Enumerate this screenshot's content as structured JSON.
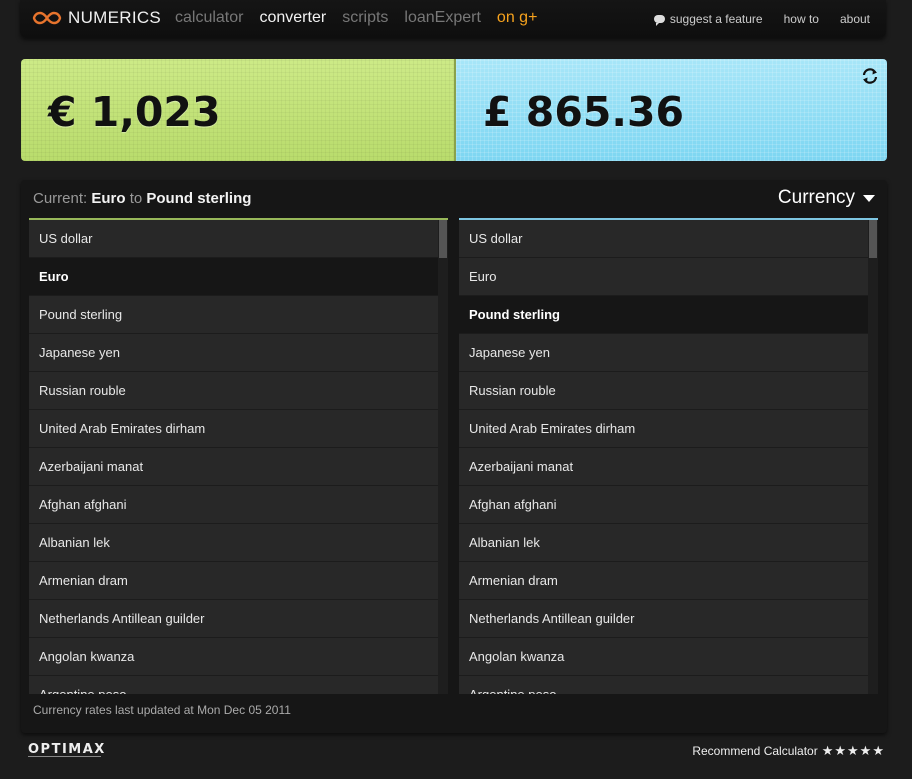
{
  "header": {
    "logo_text": "NUMERICS",
    "nav": [
      {
        "label": "calculator",
        "state": "inactive"
      },
      {
        "label": "converter",
        "state": "active"
      },
      {
        "label": "scripts",
        "state": "inactive"
      },
      {
        "label": "loanExpert",
        "state": "inactive"
      },
      {
        "label": "on g+",
        "state": "highlight"
      }
    ],
    "suggest_label": "suggest a feature",
    "howto_label": "how to",
    "about_label": "about"
  },
  "display": {
    "from_amount": "€ 1,023",
    "to_amount": "£ 865.36",
    "swap_icon": "swap-icon"
  },
  "converter": {
    "current_prefix": "Current:",
    "from_unit": "Euro",
    "to_word": "to",
    "to_unit": "Pound sterling",
    "category_label": "Currency",
    "left_selected": "Euro",
    "right_selected": "Pound sterling",
    "units": [
      "US dollar",
      "Euro",
      "Pound sterling",
      "Japanese yen",
      "Russian rouble",
      "United Arab Emirates dirham",
      "Azerbaijani manat",
      "Afghan afghani",
      "Albanian lek",
      "Armenian dram",
      "Netherlands Antillean guilder",
      "Angolan kwanza",
      "Argentine peso"
    ],
    "rates_note": "Currency rates last updated at Mon Dec 05 2011"
  },
  "footer": {
    "brand": "OPTIMAX",
    "recommend_label": "Recommend Calculator",
    "stars": "★★★★★"
  },
  "colors": {
    "accent_orange": "#f6a21d",
    "from_panel": "#c3e37a",
    "to_panel": "#8fdcf4"
  }
}
